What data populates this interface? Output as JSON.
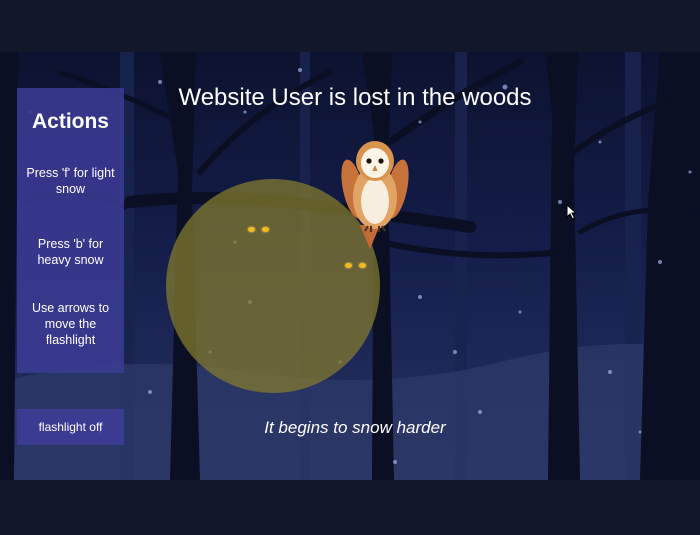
{
  "page": {
    "title": "Website User is lost in the woods",
    "status_text": "It begins to snow harder"
  },
  "actions": {
    "heading": "Actions",
    "items": [
      "Press 'f' for light snow",
      "Press 'b' for heavy snow",
      "Use arrows to move the flashlight"
    ]
  },
  "flashlight_button": {
    "label": "flashlight off"
  },
  "scene": {
    "creatures": [
      "owl-icon",
      "glowing-eyes-icon",
      "glowing-eyes-icon"
    ],
    "colors": {
      "sky": "#141d4a",
      "panel": "#3c3c96",
      "flashlight": "#877d2d",
      "eyes": "#f2b91e"
    }
  }
}
